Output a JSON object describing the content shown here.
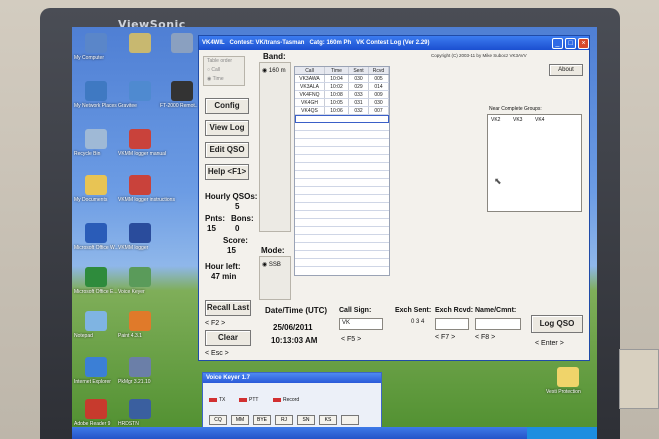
{
  "monitor": {
    "brand": "ViewSonic"
  },
  "desktop": {
    "icons": [
      {
        "label": "My Computer",
        "color": "#5a86c9"
      },
      {
        "label": "My Network Places",
        "color": "#3f79c2"
      },
      {
        "label": "Recycle Bin",
        "color": "#9fb9d6"
      },
      {
        "label": "My Documents",
        "color": "#e8c454"
      },
      {
        "label": "Microsoft Office W...",
        "color": "#2a5cb8"
      },
      {
        "label": "Microsoft Office E...",
        "color": "#2e8b3c"
      },
      {
        "label": "Notepad",
        "color": "#7fb4e2"
      },
      {
        "label": "Internet Explorer",
        "color": "#3b7fd6"
      },
      {
        "label": "Adobe Reader 9",
        "color": "#c73a2d"
      }
    ],
    "icons_col2": [
      {
        "label": "",
        "color": "#c8b870"
      },
      {
        "label": "Gravitee",
        "color": "#4f8ad0"
      },
      {
        "label": "VKMM logger manual",
        "color": "#c9423b"
      },
      {
        "label": "VKMM logger instructions",
        "color": "#c9423b"
      },
      {
        "label": "VKMM logger",
        "color": "#2a4c9c"
      },
      {
        "label": "Voice Keyer",
        "color": "#5a9b5a"
      },
      {
        "label": "Paint 4.3.1",
        "color": "#e07a2a"
      },
      {
        "label": "PkMgr 3.21.10",
        "color": "#6b7fa8"
      },
      {
        "label": "HRDSTN",
        "color": "#3a5f9f"
      }
    ],
    "icons_col3": [
      {
        "label": "",
        "color": "#8aa0c0"
      },
      {
        "label": "FT-2000 Remot...",
        "color": "#333333"
      }
    ],
    "right_icon": {
      "label": "Vesti Protection",
      "color": "#f0d46a"
    }
  },
  "app": {
    "title": "VK4WIL   Contest: VK/trans-Tasman   Catg: 160m Ph   VK Contest Log (Ver 2.29)",
    "copyright": "Copyright (C) 2003-11 by Mike Subocz VK3AVV",
    "about_label": "About",
    "band_label": "Band:",
    "band_value": "160 m",
    "table_order_label": "Table order",
    "table_order_options": [
      "Call",
      "Time"
    ],
    "buttons": {
      "config": "Config",
      "view_log": "View Log",
      "edit_qso": "Edit QSO",
      "help": "Help <F1>",
      "recall_last": "Recall Last",
      "clear": "Clear",
      "log_qso": "Log QSO"
    },
    "hourly_qsos_label": "Hourly QSOs:",
    "hourly_qsos_value": "5",
    "pnts_label": "Pnts:",
    "pnts_value": "15",
    "bons_label": "Bons:",
    "bons_value": "0",
    "score_label": "Score:",
    "score_value": "15",
    "hour_left_label": "Hour left:",
    "hour_left_value": "47 min",
    "mode_label": "Mode:",
    "mode_value": "SSB",
    "log_columns": [
      "Call",
      "Time",
      "Sent",
      "Rcvd"
    ],
    "log_rows": [
      [
        "VK3AWA",
        "10:04",
        "030",
        "005"
      ],
      [
        "VK3ALA",
        "10:02",
        "029",
        "014"
      ],
      [
        "VK4FNQ",
        "10:08",
        "033",
        "009"
      ],
      [
        "VK4GH",
        "10:05",
        "031",
        "030"
      ],
      [
        "VK4QS",
        "10:06",
        "032",
        "007"
      ]
    ],
    "groups_label": "Near Complete Groups:",
    "groups": [
      "VK2",
      "VK3",
      "VK4"
    ],
    "datetime_label": "Date/Time (UTC)",
    "date_value": "25/06/2011",
    "time_value": "10:13:03 AM",
    "call_sign_label": "Call Sign:",
    "exch_sent_label": "Exch Sent:",
    "exch_rcvd_label": "Exch Rcvd:",
    "name_cmt_label": "Name/Cmnt:",
    "exch_sent_value": "0 3 4",
    "call_sign_value": "VK",
    "hotkeys": {
      "f2": "< F2 >",
      "esc": "< Esc >",
      "f5": "< F5 >",
      "f7": "< F7 >",
      "f8": "< F8 >",
      "enter": "< Enter >"
    }
  },
  "voice_keyer": {
    "title": "Voice Keyer 1.7",
    "indicators": [
      "TX",
      "PTT",
      "Record"
    ],
    "buttons": [
      "CQ",
      "MM",
      "BYE",
      "RJ",
      "SN",
      "KS"
    ]
  }
}
